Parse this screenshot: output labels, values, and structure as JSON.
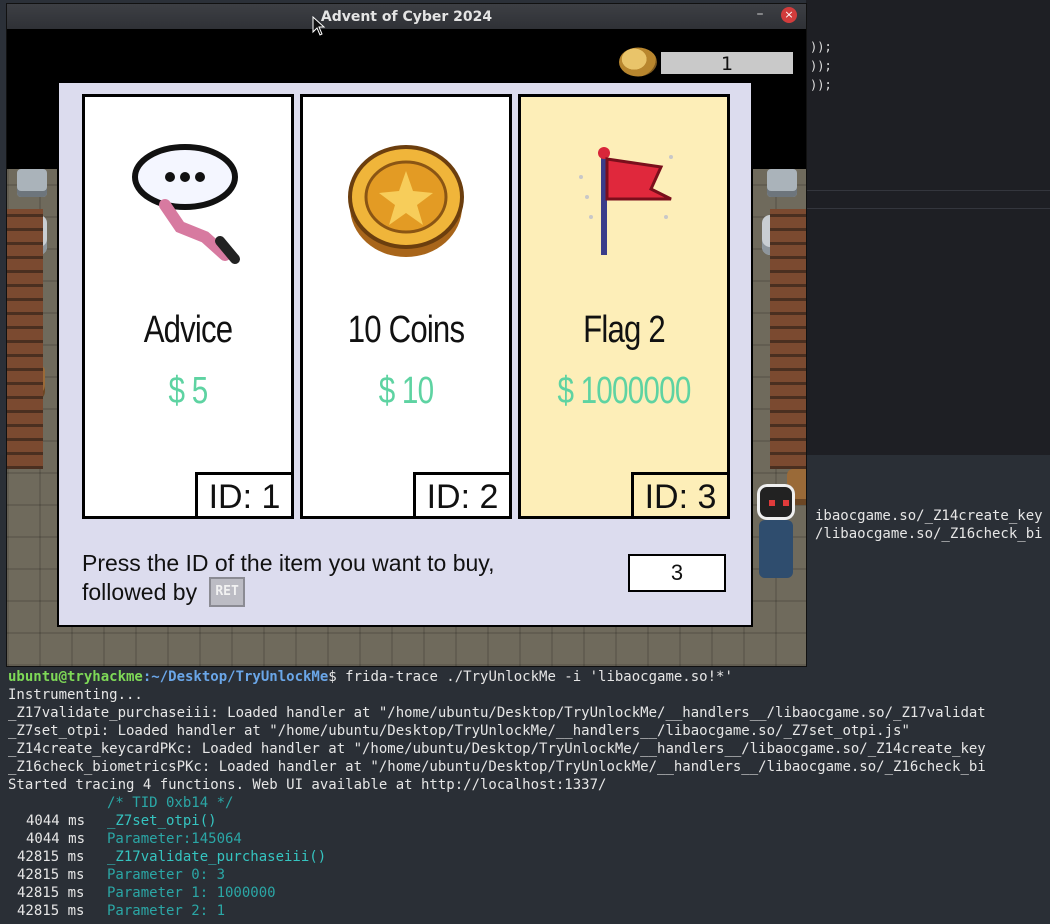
{
  "window": {
    "title": "Advent of Cyber 2024",
    "minimize_label": "–",
    "close_label": "×"
  },
  "hud": {
    "coins": "1"
  },
  "shop": {
    "items": [
      {
        "name": "Advice",
        "price": "$ 5",
        "id": "ID: 1",
        "icon": "speech-bubble-icon"
      },
      {
        "name": "10 Coins",
        "price": "$ 10",
        "id": "ID: 2",
        "icon": "coin-icon"
      },
      {
        "name": "Flag 2",
        "price": "$ 1000000",
        "id": "ID: 3",
        "icon": "flag-icon",
        "selected": true
      }
    ],
    "prompt_line1": "Press the ID of the item you want to buy,",
    "prompt_line2": "followed by",
    "ret_key": "RET",
    "input_value": "3"
  },
  "editor": {
    "lines": [
      "));",
      "));",
      "));"
    ]
  },
  "terminal": {
    "prompt_user": "ubuntu@tryhackme",
    "prompt_path": ":~/Desktop/TryUnlockMe",
    "command": "$ frida-trace ./TryUnlockMe -i 'libaocgame.so!*'",
    "lines": [
      "Instrumenting...",
      "_Z17validate_purchaseiii: Loaded handler at \"/home/ubuntu/Desktop/TryUnlockMe/__handlers__/libaocgame.so/_Z17validat",
      "_Z7set_otpi: Loaded handler at \"/home/ubuntu/Desktop/TryUnlockMe/__handlers__/libaocgame.so/_Z7set_otpi.js\"",
      "_Z14create_keycardPKc: Loaded handler at \"/home/ubuntu/Desktop/TryUnlockMe/__handlers__/libaocgame.so/_Z14create_key",
      "_Z16check_biometricsPKc: Loaded handler at \"/home/ubuntu/Desktop/TryUnlockMe/__handlers__/libaocgame.so/_Z16check_bi",
      "Started tracing 4 functions. Web UI available at http://localhost:1337/"
    ],
    "right_overflow": [
      "ibaocgame.so/_Z14create_key",
      "/libaocgame.so/_Z16check_bi"
    ],
    "tid_comment": "/* TID 0xb14 */",
    "trace": [
      {
        "time": "4044 ms",
        "text": "_Z7set_otpi()"
      },
      {
        "time": "4044 ms",
        "text": "Parameter:145064"
      },
      {
        "time": "42815 ms",
        "text": "_Z17validate_purchaseiii()"
      },
      {
        "time": "42815 ms",
        "text": "Parameter 0: 3"
      },
      {
        "time": "42815 ms",
        "text": "Parameter 1: 1000000"
      },
      {
        "time": "42815 ms",
        "text": "Parameter 2: 1"
      }
    ]
  }
}
